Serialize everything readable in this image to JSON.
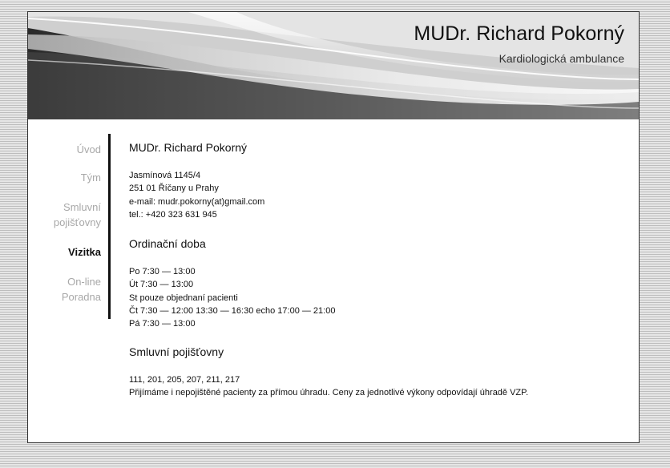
{
  "header": {
    "title": "MUDr. Richard Pokorný",
    "subtitle": "Kardiologická ambulance"
  },
  "nav": {
    "uvod": "Úvod",
    "tym": "Tým",
    "smluvni_line1": "Smluvní",
    "smluvni_line2": "pojišťovny",
    "vizitka": "Vizitka",
    "poradna_line1": "On-line",
    "poradna_line2": "Poradna",
    "active": "Vizitka"
  },
  "contact": {
    "heading": "MUDr. Richard Pokorný",
    "street": "Jasmínová 1145/4",
    "city": "251 01 Říčany u Prahy",
    "email": "e-mail: mudr.pokorny(at)gmail.com",
    "phone": "tel.: +420 323 631 945"
  },
  "hours": {
    "heading": "Ordinační doba",
    "lines": [
      "Po 7:30 — 13:00",
      "Út 7:30 — 13:00",
      "St pouze objednaní pacienti",
      "Čt 7:30 — 12:00 13:30 — 16:30 echo 17:00 — 21:00",
      "Pá 7:30 — 13:00"
    ]
  },
  "insurance": {
    "heading": "Smluvní pojišťovny",
    "codes": "111, 201, 205, 207, 211, 217",
    "note": "Přijímáme i nepojištěné pacienty za přímou úhradu. Ceny za jednotlivé výkony odpovídají úhradě VZP."
  },
  "colors": {
    "active_nav": "#111111",
    "inactive_nav": "#a8a8a8",
    "sidebar_rule": "#111111"
  }
}
